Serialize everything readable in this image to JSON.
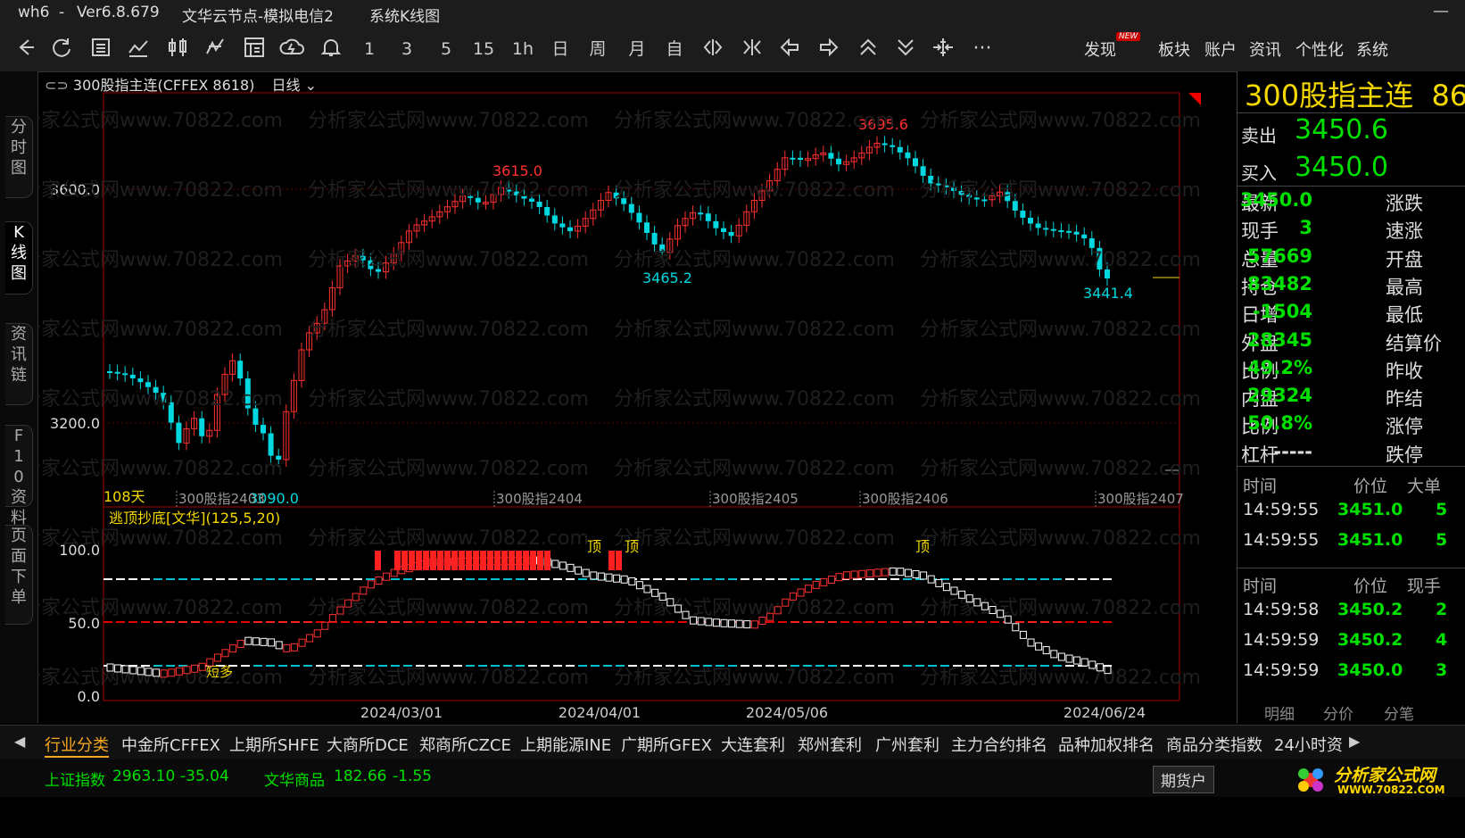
{
  "window": {
    "app": "wh6",
    "dash": "-",
    "version": "Ver6.8.679",
    "node": "文华云节点-模拟电信2",
    "view": "系统K线图",
    "minimize": "—"
  },
  "toolbar": {
    "periods": [
      "1",
      "3",
      "5",
      "15",
      "1h",
      "日",
      "周",
      "月",
      "自"
    ],
    "menus": [
      "发现",
      "板块",
      "账户",
      "资讯",
      "个性化",
      "系统"
    ],
    "new_badge": "NEW",
    "more": "···"
  },
  "sidetabs": [
    "分时图",
    "K线图",
    "资讯链",
    "F10资料",
    "页面下单"
  ],
  "chart": {
    "symbol": "300股指主连(CFFEX 8618)",
    "period": "日线",
    "price_labels": [
      "3600.0",
      "3200.0"
    ],
    "days_label": "108天",
    "contract_labels": [
      "300股指2403",
      "300股指2404",
      "300股指2405",
      "300股指2406",
      "300股指2407"
    ],
    "annotations": {
      "high1": "3615.0",
      "low1": "3465.2",
      "high2": "3695.6",
      "low2": "3441.4",
      "low0": "3090.0"
    },
    "indicator_name": "逃顶抄底[文华](125,5,20)",
    "indicator_levels": [
      "100.0",
      "50.0",
      "0.0"
    ],
    "top_marks": [
      "顶",
      "顶",
      "顶"
    ],
    "short_mark": "短多",
    "dates": [
      "2024/03/01",
      "2024/04/01",
      "2024/05/06",
      "2024/06/24"
    ],
    "watermark": "分析家公式网www.70822.com"
  },
  "quote": {
    "name": "300股指主连",
    "name_suffix": "86",
    "sell_label": "卖出",
    "sell_price": "3450.6",
    "buy_label": "买入",
    "buy_price": "3450.0",
    "rows": [
      {
        "label": "最新",
        "value": "3450.0",
        "label2": "涨跌"
      },
      {
        "label": "现手",
        "value": "3",
        "label2": "速涨"
      },
      {
        "label": "总量",
        "value": "57669",
        "label2": "开盘"
      },
      {
        "label": "持仓",
        "value": "83482",
        "label2": "最高"
      },
      {
        "label": "日增",
        "value": "-1504",
        "label2": "最低"
      },
      {
        "label": "外盘",
        "value": "28345",
        "label2": "结算价"
      },
      {
        "label": "比例",
        "value": "49.2%",
        "label2": "昨收"
      },
      {
        "label": "内盘",
        "value": "29324",
        "label2": "昨结"
      },
      {
        "label": "比例",
        "value": "50.8%",
        "label2": "涨停"
      },
      {
        "label": "杠杆",
        "value": "-----",
        "label2": "跌停"
      }
    ],
    "trade_header": [
      "时间",
      "价位",
      "大单"
    ],
    "trades": [
      {
        "time": "14:59:55",
        "price": "3451.0",
        "qty": "5"
      },
      {
        "time": "14:59:55",
        "price": "3451.0",
        "qty": "5"
      }
    ],
    "tick_header": [
      "时间",
      "价位",
      "现手"
    ],
    "ticks": [
      {
        "time": "14:59:58",
        "price": "3450.2",
        "qty": "2"
      },
      {
        "time": "14:59:59",
        "price": "3450.2",
        "qty": "4"
      },
      {
        "time": "14:59:59",
        "price": "3450.0",
        "qty": "3"
      }
    ],
    "bottom_tabs": [
      "明细",
      "分价",
      "分笔"
    ]
  },
  "bottom_tabs": [
    "行业分类",
    "中金所CFFEX",
    "上期所SHFE",
    "大商所DCE",
    "郑商所CZCE",
    "上期能源INE",
    "广期所GFEX",
    "大连套利",
    "郑州套利",
    "广州套利",
    "主力合约排名",
    "品种加权排名",
    "商品分类指数",
    "24小时资"
  ],
  "status": {
    "idx1_name": "上证指数",
    "idx1_value": "2963.10",
    "idx1_change": "-35.04",
    "idx2_name": "文华商品",
    "idx2_value": "182.66",
    "idx2_change": "-1.55",
    "account_button": "期货户"
  },
  "logo": {
    "text": "分析家公式网",
    "url": "WWW.70822.COM"
  },
  "colors": {
    "up": "#ff3030",
    "down": "#00d8e0",
    "accent": "#f5d800",
    "green": "#00e000",
    "bg": "#000000"
  },
  "chart_data": {
    "type": "candlestick",
    "period": "日线",
    "price_ticks": [
      3600.0,
      3200.0
    ],
    "marked_high": 3695.6,
    "marked_low": 3090.0,
    "last_price": 3450.0,
    "indicator_ticks": [
      100.0,
      50.0,
      0.0
    ],
    "x_dates": [
      "2024/03/01",
      "2024/04/01",
      "2024/05/06",
      "2024/06/24"
    ]
  }
}
